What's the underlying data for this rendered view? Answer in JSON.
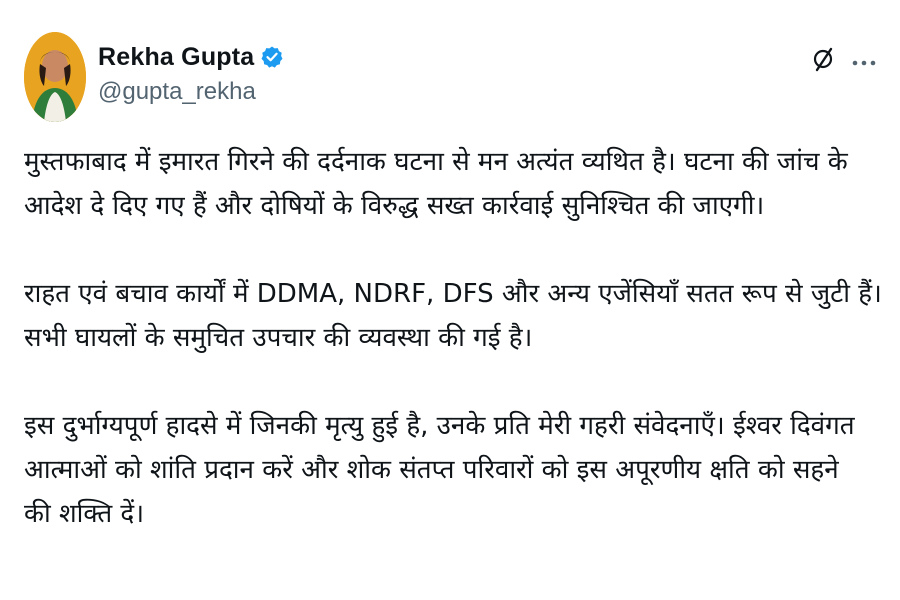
{
  "author": {
    "display_name": "Rekha Gupta",
    "handle": "@gupta_rekha"
  },
  "icons": {
    "verified": "verified-badge-icon",
    "grok": "grok-icon",
    "more": "more-options-icon"
  },
  "colors": {
    "verified_blue": "#1d9bf0",
    "text_primary": "#0f1419",
    "text_secondary": "#536471"
  },
  "tweet": {
    "paragraphs": [
      {
        "lines": [
          "मुस्तफाबाद में इमारत गिरने की दर्दनाक घटना से मन अत्यंत व्यथित है। घटना की जांच के",
          "आदेश दे दिए गए हैं और दोषियों के विरुद्ध सख्त कार्रवाई सुनिश्चित की जाएगी।"
        ]
      },
      {
        "lines": [
          "राहत एवं बचाव कार्यों में DDMA, NDRF, DFS और अन्य एजेंसियाँ सतत रूप से जुटी हैं।",
          "सभी घायलों के समुचित उपचार की व्यवस्था की गई है।"
        ]
      },
      {
        "lines": [
          "इस दुर्भाग्यपूर्ण हादसे में जिनकी मृत्यु हुई है, उनके प्रति मेरी गहरी संवेदनाएँ। ईश्वर दिवंगत",
          "आत्माओं को शांति प्रदान करें और शोक संतप्त परिवारों को इस अपूरणीय क्षति को सहने",
          "की शक्ति दें।"
        ]
      }
    ]
  }
}
